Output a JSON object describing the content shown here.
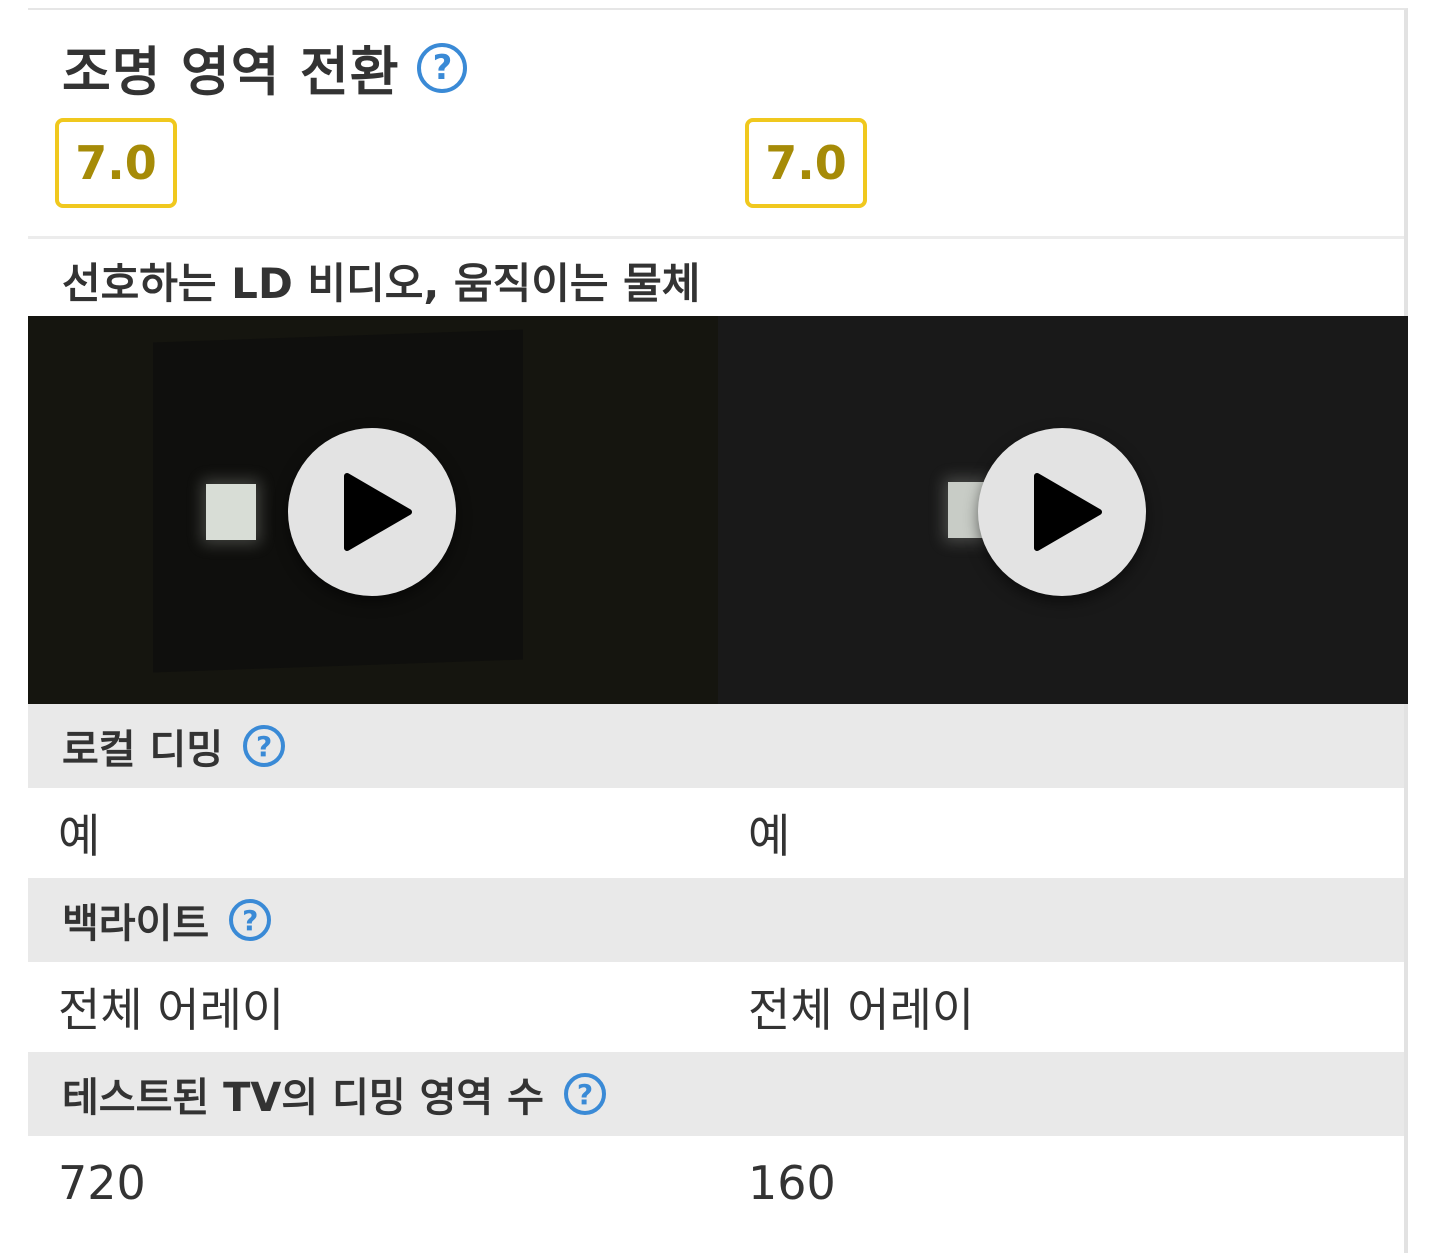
{
  "section": {
    "title": "조명 영역 전환",
    "help_glyph": "?"
  },
  "scores": [
    "7.0",
    "7.0"
  ],
  "video_section": {
    "title": "선호하는 LD 비디오, 움직이는 물체"
  },
  "rows": [
    {
      "label": "로컬 디밍",
      "values": [
        "예",
        "예"
      ]
    },
    {
      "label": "백라이트",
      "values": [
        "전체 어레이",
        "전체 어레이"
      ]
    },
    {
      "label": "테스트된 TV의 디밍 영역 수",
      "values": [
        "720",
        "160"
      ]
    }
  ],
  "colors": {
    "help_icon": "#3a8ad6",
    "score_border": "#f0c81e",
    "score_text": "#a68b08",
    "row_header_bg": "#e9e9e9"
  }
}
